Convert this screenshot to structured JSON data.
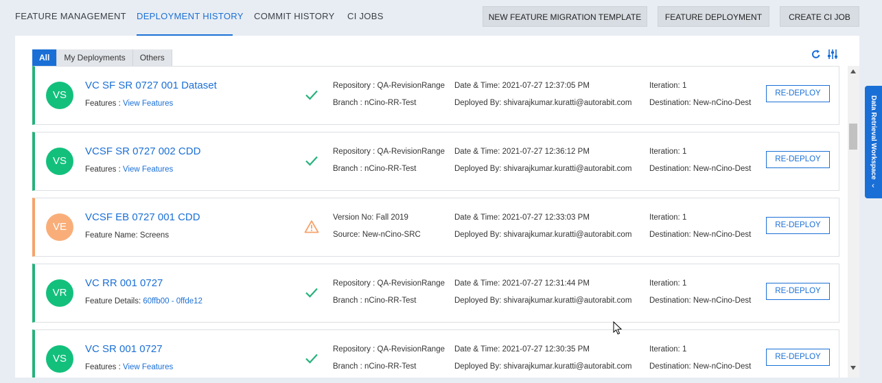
{
  "topnav": {
    "tabs": [
      {
        "label": "FEATURE MANAGEMENT"
      },
      {
        "label": "DEPLOYMENT HISTORY"
      },
      {
        "label": "COMMIT HISTORY"
      },
      {
        "label": "CI JOBS"
      }
    ],
    "active_tab": "DEPLOYMENT HISTORY",
    "buttons": {
      "new_template": "NEW FEATURE MIGRATION TEMPLATE",
      "feature_deployment": "FEATURE DEPLOYMENT",
      "create_ci_job": "CREATE CI JOB"
    }
  },
  "subtabs": [
    {
      "label": "All"
    },
    {
      "label": "My Deployments"
    },
    {
      "label": "Others"
    }
  ],
  "active_subtab": "All",
  "colors": {
    "accent": "#1a6fd6",
    "success": "#25b27a",
    "warning": "#f6a26a",
    "avatar_success": "#12c07c",
    "avatar_warning": "#f9ae79"
  },
  "icons": {
    "refresh": "refresh-icon",
    "filter": "sliders-icon",
    "success": "check-icon",
    "warning": "warning-triangle-icon"
  },
  "cards": [
    {
      "initials": "VS",
      "title": "VC SF SR 0727 001 Dataset",
      "line2_label": "Features :",
      "line2_value": "View Features",
      "status": "success",
      "meta1_a": "Repository : QA-RevisionRange",
      "meta1_b": "Branch : nCino-RR-Test",
      "meta2_a": "Date & Time: 2021-07-27 12:37:05 PM",
      "meta2_b": "Deployed By: shivarajkumar.kuratti@autorabit.com",
      "meta3_a": "Iteration: 1",
      "meta3_b": "Destination: New-nCino-Dest",
      "button": "RE-DEPLOY"
    },
    {
      "initials": "VS",
      "title": "VCSF SR 0727 002 CDD",
      "line2_label": "Features :",
      "line2_value": "View Features",
      "status": "success",
      "meta1_a": "Repository : QA-RevisionRange",
      "meta1_b": "Branch : nCino-RR-Test",
      "meta2_a": "Date & Time: 2021-07-27 12:36:12 PM",
      "meta2_b": "Deployed By: shivarajkumar.kuratti@autorabit.com",
      "meta3_a": "Iteration: 1",
      "meta3_b": "Destination: New-nCino-Dest",
      "button": "RE-DEPLOY"
    },
    {
      "initials": "VE",
      "title": "VCSF EB 0727 001 CDD",
      "line2_label": "Feature Name: Screens",
      "line2_value": "",
      "status": "warning",
      "meta1_a": "Version No: Fall 2019",
      "meta1_b": "Source: New-nCino-SRC",
      "meta2_a": "Date & Time: 2021-07-27 12:33:03 PM",
      "meta2_b": "Deployed By: shivarajkumar.kuratti@autorabit.com",
      "meta3_a": "Iteration: 1",
      "meta3_b": "Destination: New-nCino-Dest",
      "button": "RE-DEPLOY"
    },
    {
      "initials": "VR",
      "title": "VC RR 001 0727",
      "line2_label": "Feature Details:",
      "line2_value": "60ffb00 - 0ffde12",
      "status": "success",
      "meta1_a": "Repository : QA-RevisionRange",
      "meta1_b": "Branch : nCino-RR-Test",
      "meta2_a": "Date & Time: 2021-07-27 12:31:44 PM",
      "meta2_b": "Deployed By: shivarajkumar.kuratti@autorabit.com",
      "meta3_a": "Iteration: 1",
      "meta3_b": "Destination: New-nCino-Dest",
      "button": "RE-DEPLOY"
    },
    {
      "initials": "VS",
      "title": "VC SR 001 0727",
      "line2_label": "Features :",
      "line2_value": "View Features",
      "status": "success",
      "meta1_a": "Repository : QA-RevisionRange",
      "meta1_b": "Branch : nCino-RR-Test",
      "meta2_a": "Date & Time: 2021-07-27 12:30:35 PM",
      "meta2_b": "Deployed By: shivarajkumar.kuratti@autorabit.com",
      "meta3_a": "Iteration: 1",
      "meta3_b": "Destination: New-nCino-Dest",
      "button": "RE-DEPLOY"
    }
  ],
  "workspace_tab": {
    "label": "Data Retrieval Workspace",
    "chevron": "‹"
  }
}
